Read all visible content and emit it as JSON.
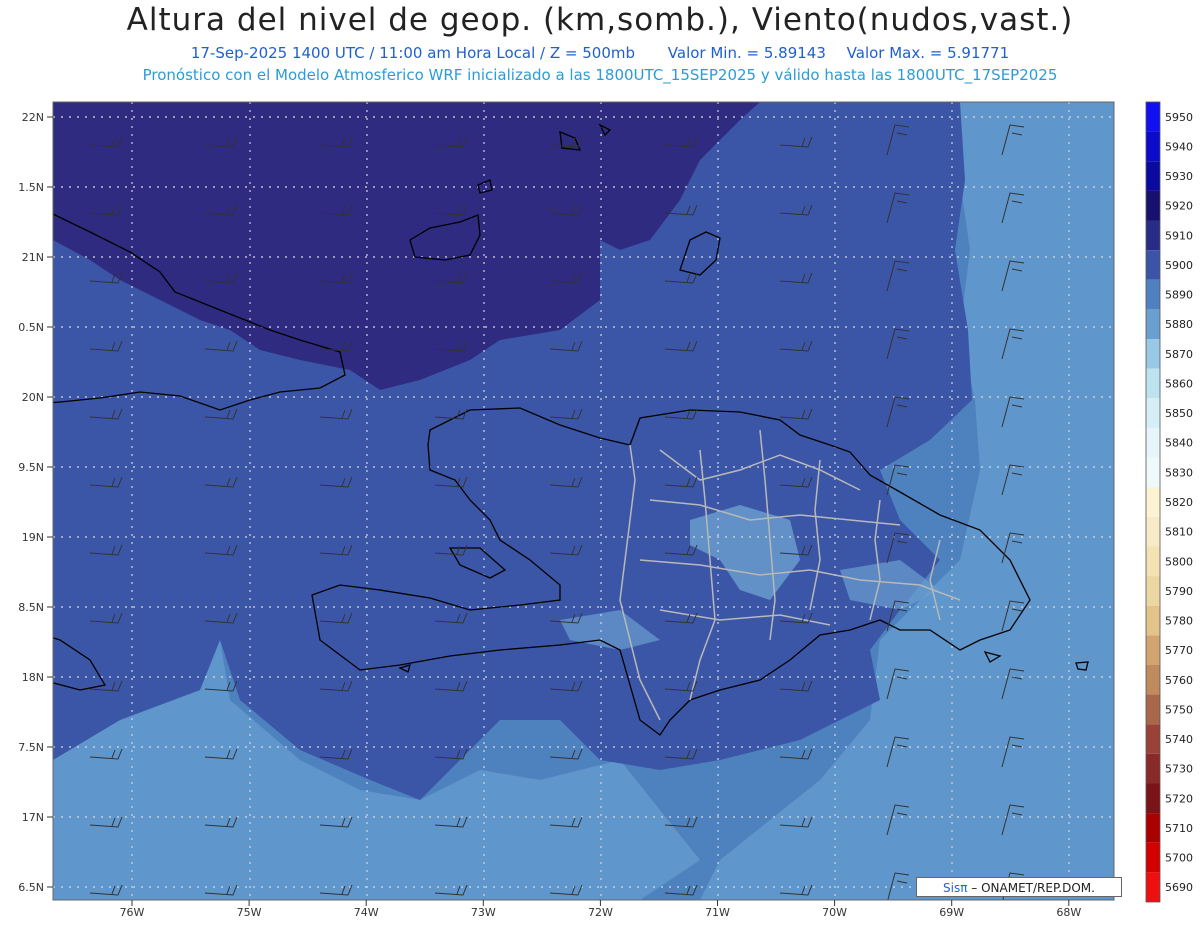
{
  "header": {
    "title": "Altura del nivel de geop. (km,somb.), Viento(nudos,vast.)",
    "line1": "17-Sep-2025  1400 UTC / 11:00 am Hora Local / Z = 500mb",
    "min_label": "Valor Min. = 5.89143",
    "max_label": "Valor Max. = 5.91771",
    "line2": "Pronóstico con el Modelo Atmosferico WRF inicializado a las 1800UTC_15SEP2025 y válido hasta las  1800UTC_17SEP2025"
  },
  "axes": {
    "lat_labels": [
      "22N",
      "1.5N",
      "21N",
      "0.5N",
      "20N",
      "9.5N",
      "19N",
      "8.5N",
      "18N",
      "7.5N",
      "17N",
      "6.5N"
    ],
    "lon_labels": [
      "76W",
      "75W",
      "74W",
      "73W",
      "72W",
      "71W",
      "70W",
      "69W",
      "68W"
    ]
  },
  "colorbar": {
    "levels": [
      "5950",
      "5940",
      "5930",
      "5920",
      "5910",
      "5900",
      "5890",
      "5880",
      "5870",
      "5860",
      "5850",
      "5840",
      "5830",
      "5820",
      "5810",
      "5800",
      "5790",
      "5780",
      "5770",
      "5760",
      "5750",
      "5740",
      "5730",
      "5720",
      "5710",
      "5700",
      "5690"
    ],
    "colors": [
      "#1010f0",
      "#0b0bcc",
      "#0a0a9e",
      "#17106e",
      "#282c86",
      "#3c54a8",
      "#5080c0",
      "#6aa0d0",
      "#98c8e6",
      "#bde3ef",
      "#d6eef6",
      "#e5f5fa",
      "#eef9fc",
      "#fbf3d2",
      "#f6ebc4",
      "#f2e2b4",
      "#ecd7a2",
      "#e2c48a",
      "#d2a570",
      "#bf8a5c",
      "#a8664a",
      "#9a4238",
      "#8a2a28",
      "#7a1418",
      "#aa0000",
      "#d40000",
      "#ee1010"
    ]
  },
  "colors": {
    "geop_5920": "#2e2b80",
    "geop_5910": "#3b57a6",
    "geop_5900": "#4e82bf",
    "geop_5890": "#5f96cb",
    "coast": "#000000",
    "provinces": "#b8b8b8"
  },
  "credit": {
    "brand": "Sisπ",
    "org": " – ONAMET/REP.DOM."
  }
}
